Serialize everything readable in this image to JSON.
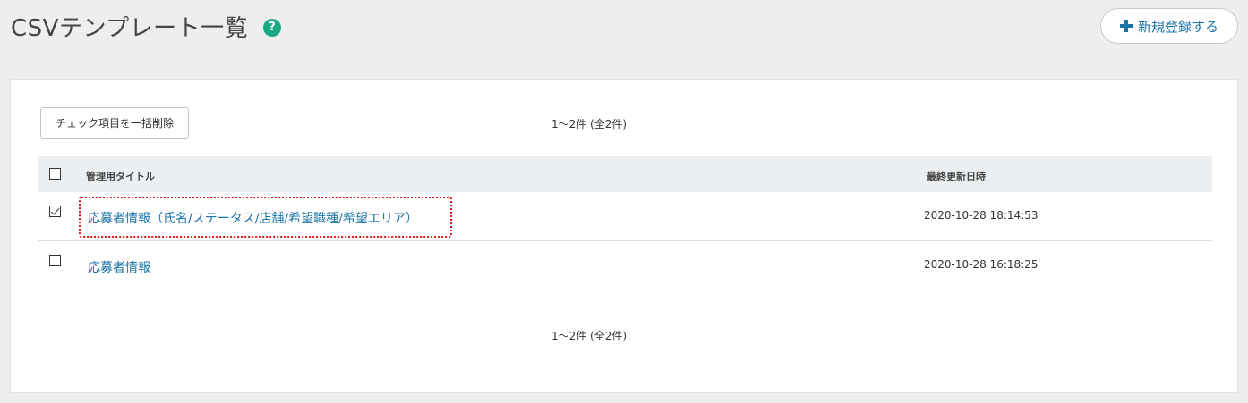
{
  "header": {
    "title": "CSVテンプレート一覧",
    "help_icon": "?",
    "new_button_label": "新規登録する",
    "new_button_icon": "plus-icon"
  },
  "toolbar": {
    "bulk_delete_label": "チェック項目を一括削除"
  },
  "pagination": {
    "top_count": "1〜2件 (全2件)",
    "bottom_count": "1〜2件 (全2件)"
  },
  "table": {
    "columns": {
      "title": "管理用タイトル",
      "updated_at": "最終更新日時"
    },
    "header_checked": false,
    "rows": [
      {
        "title": "応募者情報（氏名/ステータス/店舗/希望職種/希望エリア）",
        "updated_at": "2020-10-28 18:14:53",
        "checked": true
      },
      {
        "title": "応募者情報",
        "updated_at": "2020-10-28 16:18:25",
        "checked": false
      }
    ]
  },
  "colors": {
    "accent": "#1a73a8",
    "help": "#1aa886",
    "highlight": "#e0161b"
  }
}
